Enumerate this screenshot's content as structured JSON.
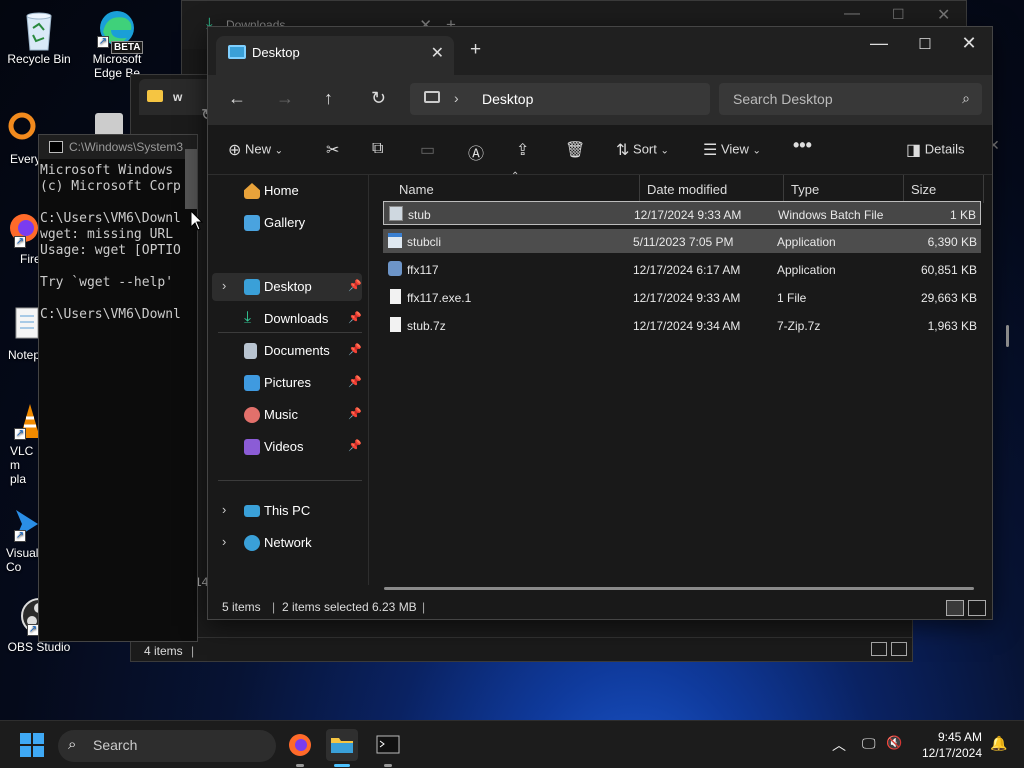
{
  "desktop": {
    "icons": [
      {
        "label": "Recycle Bin"
      },
      {
        "label": "Microsoft Edge Be",
        "badge": "BETA"
      },
      {
        "label": "Every"
      },
      {
        "label": "Fire"
      },
      {
        "label": "Notep"
      },
      {
        "label": "VLC m pla"
      },
      {
        "label": "Visual Co"
      },
      {
        "label": "OBS Studio"
      }
    ]
  },
  "back_window": {
    "tab_title": "Downloads"
  },
  "third_window": {
    "tab_title": "w",
    "status_count": "4 items"
  },
  "cmd_window": {
    "title": "C:\\Windows\\System3",
    "lines": "Microsoft Windows\n(c) Microsoft Corp\n\nC:\\Users\\VM6\\Downl\nwget: missing URL\nUsage: wget [OPTIO\n\nTry `wget --help'\n\nC:\\Users\\VM6\\Downl"
  },
  "explorer": {
    "tab_title": "Desktop",
    "address_location": "Desktop",
    "search_placeholder": "Search Desktop",
    "commands": {
      "new": "New",
      "sort": "Sort",
      "view": "View",
      "details": "Details"
    },
    "nav": {
      "home": "Home",
      "gallery": "Gallery",
      "pinned": [
        {
          "label": "Desktop"
        },
        {
          "label": "Downloads"
        },
        {
          "label": "Documents"
        },
        {
          "label": "Pictures"
        },
        {
          "label": "Music"
        },
        {
          "label": "Videos"
        }
      ],
      "this_pc": "This PC",
      "network": "Network"
    },
    "columns": {
      "name": "Name",
      "date": "Date modified",
      "type": "Type",
      "size": "Size"
    },
    "files": [
      {
        "name": "stub",
        "date": "12/17/2024 9:33 AM",
        "type": "Windows Batch File",
        "size": "1 KB",
        "selected": true
      },
      {
        "name": "stubcli",
        "date": "5/11/2023 7:05 PM",
        "type": "Application",
        "size": "6,390 KB",
        "selected": true
      },
      {
        "name": "ffx117",
        "date": "12/17/2024 6:17 AM",
        "type": "Application",
        "size": "60,851 KB",
        "selected": false
      },
      {
        "name": "ffx117.exe.1",
        "date": "12/17/2024 9:33 AM",
        "type": "1 File",
        "size": "29,663 KB",
        "selected": false
      },
      {
        "name": "stub.7z",
        "date": "12/17/2024 9:34 AM",
        "type": "7-Zip.7z",
        "size": "1,963 KB",
        "selected": false
      }
    ],
    "status": {
      "count": "5 items",
      "selection": "2 items selected",
      "sel_size": "6.23 MB"
    }
  },
  "taskbar": {
    "search_label": "Search",
    "time": "9:45 AM",
    "date": "12/17/2024"
  },
  "colors": {
    "accent": "#3fa9f5",
    "selection": "#4d4d4d",
    "window_bg": "#191919"
  }
}
